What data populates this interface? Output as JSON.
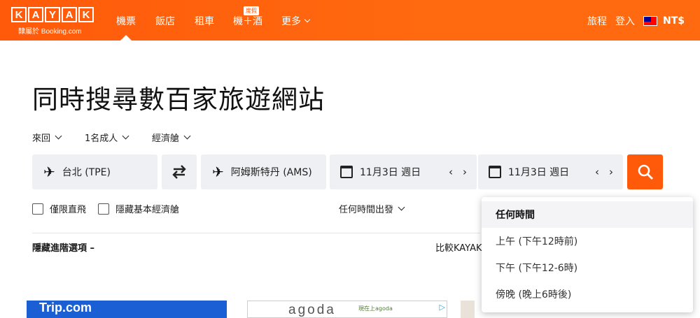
{
  "header": {
    "logo_letters": [
      "K",
      "A",
      "Y",
      "A",
      "K"
    ],
    "logo_sub": "隸屬於 Booking.com",
    "nav": [
      {
        "label": "機票",
        "active": true
      },
      {
        "label": "飯店",
        "active": false
      },
      {
        "label": "租車",
        "active": false
      },
      {
        "label": "機＋酒",
        "active": false
      },
      {
        "label": "更多",
        "active": false
      }
    ],
    "badge": "度假",
    "trips": "旅程",
    "login": "登入",
    "currency": "NT$"
  },
  "main": {
    "title": "同時搜尋數百家旅遊網站",
    "trip_type": "來回",
    "travelers": "1名成人",
    "cabin": "經濟艙",
    "origin": "台北 (TPE)",
    "destination": "阿姆斯特丹 (AMS)",
    "depart_date": "11月3日 週日",
    "return_date": "11月3日 週日",
    "nonstop": "僅限直飛",
    "hide_basic": "隱藏基本經濟艙",
    "depart_time": "任何時間出發",
    "advanced": "隱藏進階選項 –",
    "compare": "比較KAYAK"
  },
  "dropdown": {
    "items": [
      "任何時間",
      "上午 (下午12時前)",
      "下午 (下午12-6時)",
      "傍晚 (晚上6時後)"
    ],
    "selected_index": 0
  },
  "ads": {
    "ad1_text": "Trip.com",
    "ad2_brand": "agoda",
    "ad2_text": "現在上agoda",
    "ad_info": "▷"
  },
  "colors": {
    "brand": "#ff5a0a"
  }
}
